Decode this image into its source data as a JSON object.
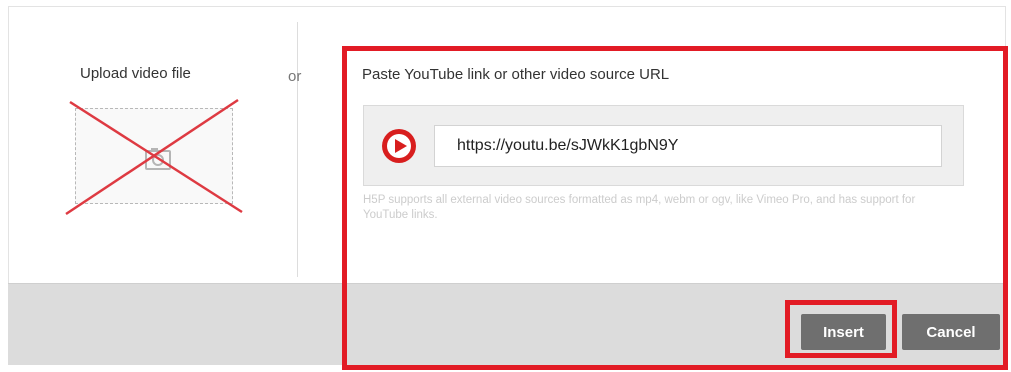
{
  "upload": {
    "title": "Upload video file",
    "icon": "image-upload-icon"
  },
  "divider": {
    "or_label": "or"
  },
  "url_section": {
    "title": "Paste YouTube link or other video source URL",
    "icon": "youtube-play-icon",
    "input_value": "https://youtu.be/sJWkK1gbN9Y",
    "support_text": "H5P supports all external video sources formatted as mp4, webm or ogv, like Vimeo Pro, and has support for YouTube links."
  },
  "actions": {
    "insert_label": "Insert",
    "cancel_label": "Cancel"
  },
  "colors": {
    "highlight": "#e21b25",
    "youtube_red": "#d81e1e",
    "button_gray": "#6f6f6f",
    "footer_gray": "#dcdcdc"
  }
}
